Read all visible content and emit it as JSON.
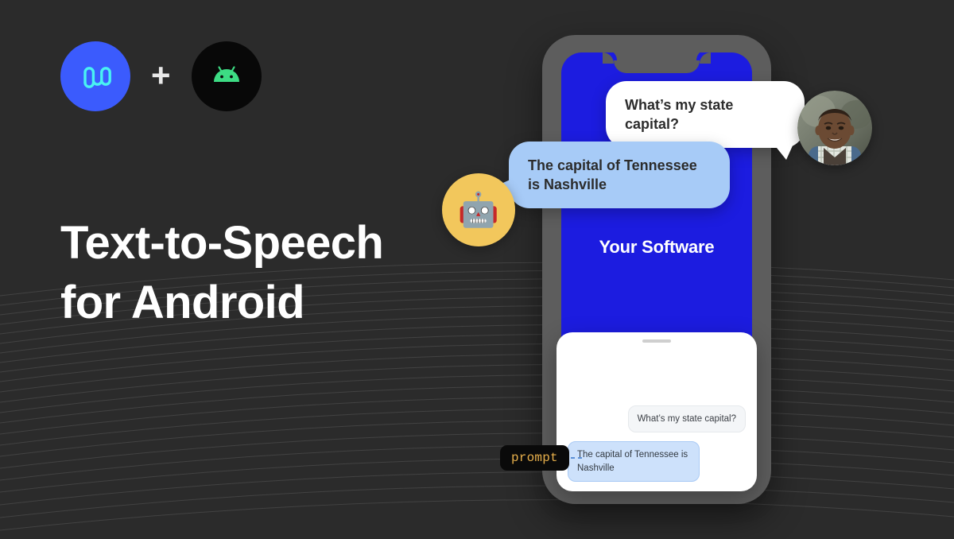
{
  "page": {
    "background_color": "#2b2b2b",
    "accent_blue": "#3b5bfd",
    "screen_blue": "#1c1ce0",
    "bubble_blue": "#a7cbf7",
    "prompt_gold": "#e8b04b"
  },
  "brand": {
    "product_logo_icon": "product-wave-logo-icon",
    "plus_symbol": "+",
    "android_logo_icon": "android-robot-icon"
  },
  "headline": {
    "line1": "Text-to-Speech",
    "line2": "for Android"
  },
  "phone": {
    "app_title": "Your Software",
    "notch_icon": "phone-notch",
    "sheet": {
      "handle_icon": "drag-handle-icon",
      "messages": [
        {
          "role": "user",
          "text": "What’s my state capital?"
        },
        {
          "role": "bot",
          "text": "The capital of Tennessee is Nashville"
        }
      ]
    }
  },
  "prompt_tag": {
    "label": "prompt",
    "connector_icon": "dashed-connector-icon"
  },
  "speech": {
    "user_bubble": "What’s my state capital?",
    "bot_bubble": "The capital of Tennessee is Nashville",
    "user_avatar_icon": "user-photo-avatar",
    "bot_avatar_icon": "robot-face-icon",
    "bot_avatar_glyph": "🤖"
  }
}
